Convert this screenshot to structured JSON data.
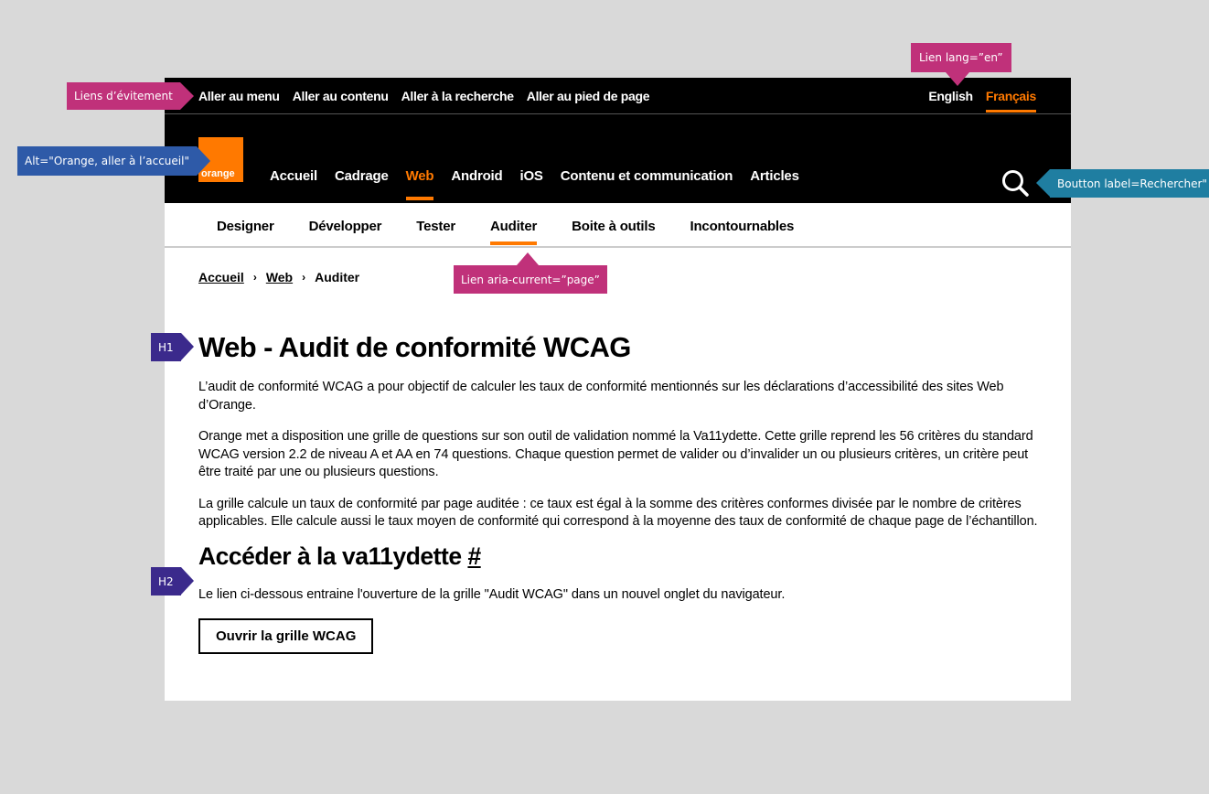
{
  "skip_links": {
    "menu": "Aller au menu",
    "content": "Aller au contenu",
    "search": "Aller à la recherche",
    "footer": "Aller au pied de page"
  },
  "language": {
    "english": "English",
    "french": "Français"
  },
  "logo": {
    "text": "orange",
    "color": "#ff7900"
  },
  "main_nav": {
    "items": [
      "Accueil",
      "Cadrage",
      "Web",
      "Android",
      "iOS",
      "Contenu et communication",
      "Articles"
    ],
    "active": "Web"
  },
  "search": {
    "icon": "search-icon"
  },
  "sub_nav": {
    "items": [
      "Designer",
      "Développer",
      "Tester",
      "Auditer",
      "Boite à outils",
      "Incontournables"
    ],
    "active": "Auditer"
  },
  "breadcrumb": {
    "home": "Accueil",
    "section": "Web",
    "current": "Auditer",
    "separator": "›"
  },
  "content": {
    "h1": "Web - Audit de conformité WCAG",
    "p1": "L’audit de conformité WCAG a pour objectif de calculer les taux de conformité mentionnés sur les déclarations d’accessibilité des sites Web d’Orange.",
    "p2": "Orange met a disposition une grille de questions sur son outil de validation nommé la Va11ydette. Cette grille reprend les 56 critères du standard WCAG version 2.2 de niveau A et AA en 74 questions. Chaque question permet de valider ou d’invalider un ou plusieurs critères, un critère peut être traité par une ou plusieurs questions.",
    "p3": "La grille calcule un taux de conformité par page auditée : ce taux est égal à la somme des critères conformes divisée par le nombre de critères applicables. Elle calcule aussi le taux moyen de conformité qui correspond à la moyenne des taux de conformité de chaque page de l’échantillon.",
    "h2": "Accéder à la va11ydette",
    "h2_anchor": "#",
    "p4": "Le lien ci-dessous entraine l'ouverture de la grille \"Audit WCAG\" dans un nouvel onglet du navigateur.",
    "cta": "Ouvrir la grille WCAG"
  },
  "annotations": {
    "skip": "Liens d’évitement",
    "alt": "Alt=\"Orange, aller à l’accueil\"",
    "lang": "Lien lang=”en”",
    "search": "Boutton label=Rechercher\"",
    "aria": "Lien aria-current=”page”",
    "h1": "H1",
    "h2": "H2"
  },
  "colors": {
    "accent": "#ff7900",
    "annotation_pink": "#c0317a",
    "annotation_blue": "#2e5aa8",
    "annotation_teal": "#1f7ea1",
    "annotation_purple": "#3b2a8c"
  }
}
